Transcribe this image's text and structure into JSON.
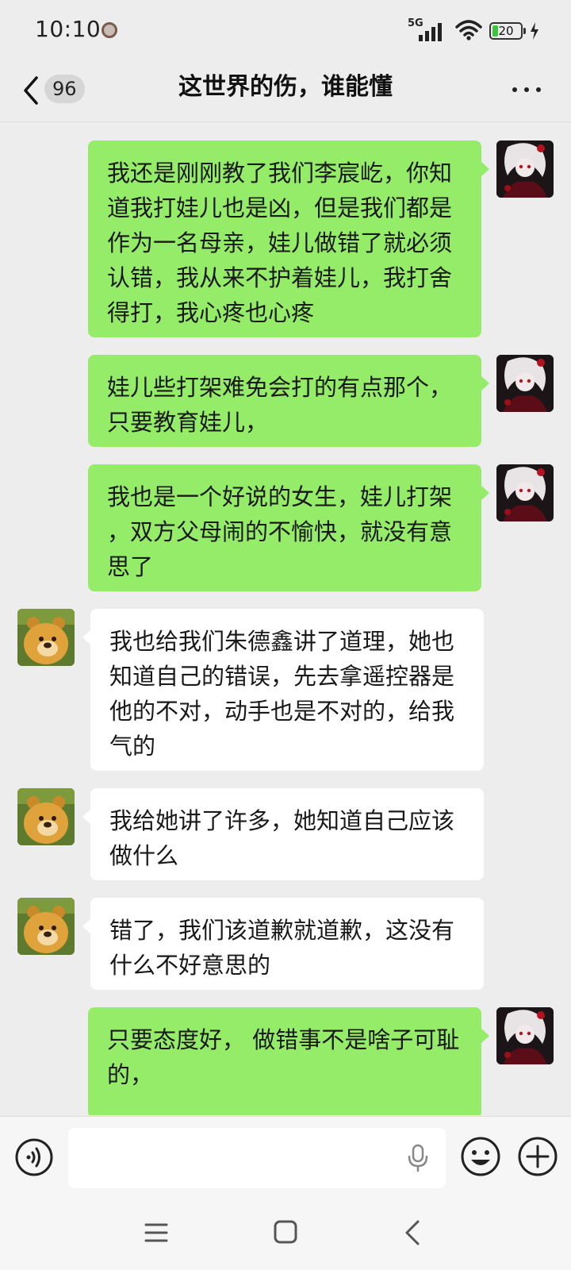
{
  "status": {
    "time": "10:10",
    "network": "5G",
    "battery": "20",
    "battery_level_percent": 20
  },
  "header": {
    "unread_count": "96",
    "title": "这世界的伤，谁能懂",
    "icons": {
      "back": "chevron-left-icon",
      "more": "more-dots-icon"
    }
  },
  "messages": [
    {
      "side": "out",
      "text": "我还是刚刚教了我们李宸屹，你知道我打娃儿也是凶，但是我们都是作为一名母亲，娃儿做错了就必须认错，我从来不护着娃儿，我打舍得打，我心疼也心疼"
    },
    {
      "side": "out",
      "text": "娃儿些打架难免会打的有点那个，只要教育娃儿，"
    },
    {
      "side": "out",
      "text": "我也是一个好说的女生，娃儿打架 ，双方父母闹的不愉快，就没有意思了"
    },
    {
      "side": "in",
      "text": "我也给我们朱德鑫讲了道理，她也知道自己的错误，先去拿遥控器是他的不对，动手也是不对的，给我气的"
    },
    {
      "side": "in",
      "text": "我给她讲了许多，她知道自己应该做什么"
    },
    {
      "side": "in",
      "text": "错了，我们该道歉就道歉，这没有什么不好意思的"
    },
    {
      "side": "out",
      "text": "只要态度好， 做错事不是啥子可耻的，"
    }
  ],
  "input_bar": {
    "placeholder": "",
    "icons": {
      "voice": "voice-icon",
      "mic": "mic-icon",
      "emoji": "emoji-icon",
      "plus": "plus-icon"
    }
  },
  "colors": {
    "outgoing_bubble": "#95ec69",
    "incoming_bubble": "#ffffff",
    "background": "#ededed"
  }
}
